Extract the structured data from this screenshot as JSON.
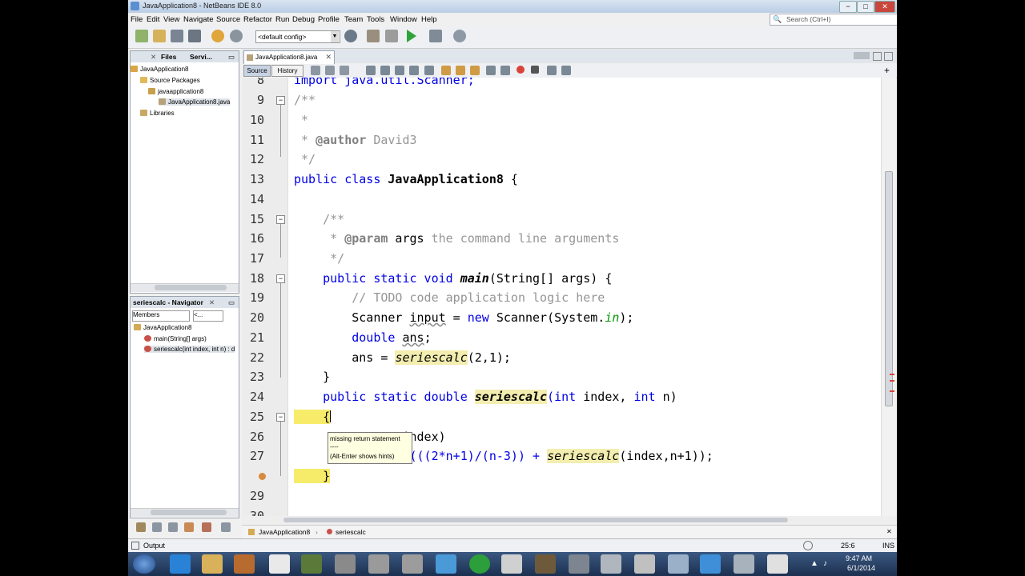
{
  "window": {
    "title": "JavaApplication8 - NetBeans IDE 8.0",
    "min": "−",
    "max": "□",
    "close": "✕"
  },
  "menu": [
    "File",
    "Edit",
    "View",
    "Navigate",
    "Source",
    "Refactor",
    "Run",
    "Debug",
    "Profile",
    "Team",
    "Tools",
    "Window",
    "Help"
  ],
  "search": {
    "placeholder": "Search (Ctrl+I)"
  },
  "toolbar": {
    "config": "<default config>"
  },
  "projects_panel": {
    "tabs": [
      "Files",
      "Servi..."
    ],
    "tree": [
      {
        "label": "JavaApplication8",
        "depth": 0
      },
      {
        "label": "Source Packages",
        "depth": 1
      },
      {
        "label": "javaapplication8",
        "depth": 2
      },
      {
        "label": "JavaApplication8.java",
        "depth": 3,
        "selected": true
      },
      {
        "label": "Libraries",
        "depth": 1
      }
    ]
  },
  "navigator_panel": {
    "title": "seriescalc - Navigator",
    "filter": "Members",
    "filter2": "<...",
    "tree": [
      {
        "label": "JavaApplication8",
        "depth": 0
      },
      {
        "label": "main(String[] args)",
        "depth": 1
      },
      {
        "label": "seriescalc(int index, int n) : d",
        "depth": 1,
        "selected": true
      }
    ]
  },
  "editor": {
    "tab": "JavaApplication8.java",
    "source_btn": "Source",
    "history_btn": "History",
    "line_numbers": [
      "8",
      "9",
      "10",
      "11",
      "12",
      "13",
      "14",
      "15",
      "16",
      "17",
      "18",
      "19",
      "20",
      "21",
      "22",
      "23",
      "24",
      "25",
      "26",
      "27",
      "",
      "29",
      "30"
    ],
    "tooltip": {
      "line1": "missing return statement",
      "line2": "----",
      "line3": "(Alt-Enter shows hints)"
    }
  },
  "code": {
    "l8": "import java.util.Scanner;",
    "l9": "/**",
    "l10": " *",
    "l11_a": " * ",
    "l11_b": "@author",
    "l11_c": " David3",
    "l12": " */",
    "l13_a": "public class ",
    "l13_b": "JavaApplication8",
    "l13_c": " {",
    "l15": "    /**",
    "l16_a": "     * ",
    "l16_b": "@param",
    "l16_c": " args",
    "l16_d": " the command line arguments",
    "l17": "     */",
    "l18_a": "    public static void ",
    "l18_b": "main",
    "l18_c": "(String[] args) {",
    "l19": "        // TODO code application logic here",
    "l20_a": "        Scanner ",
    "l20_b": "input",
    "l20_c": " = ",
    "l20_d": "new",
    "l20_e": " Scanner(System.",
    "l20_f": "in",
    "l20_g": ");",
    "l21_a": "        double ",
    "l21_b": "ans",
    "l21_c": ";",
    "l22_a": "        ans = ",
    "l22_b": "seriescalc",
    "l22_c": "(2,1);",
    "l23": "    }",
    "l24_a": "    public static double ",
    "l24_b": "seriescalc",
    "l24_c": "(int",
    "l24_d": " index, ",
    "l24_e": "int",
    "l24_f": " n)",
    "l25": "    {",
    "l26": "             < index)",
    "l27_a": "           turn (((2*n+1)/(n-3)) + ",
    "l27_b": "seriescalc",
    "l27_c": "(index,n+1));",
    "l28": "    }"
  },
  "breadcrumbs": [
    "JavaApplication8",
    "seriescalc"
  ],
  "status": {
    "output": "Output",
    "position": "25:6",
    "mode": "INS"
  },
  "taskbar": {
    "time": "9:47 AM",
    "date": "6/1/2014"
  },
  "colors": {
    "keyword": "#0000e6",
    "comment": "#969696",
    "highlight": "#f3eeb0",
    "current_line": "#e9effa"
  }
}
